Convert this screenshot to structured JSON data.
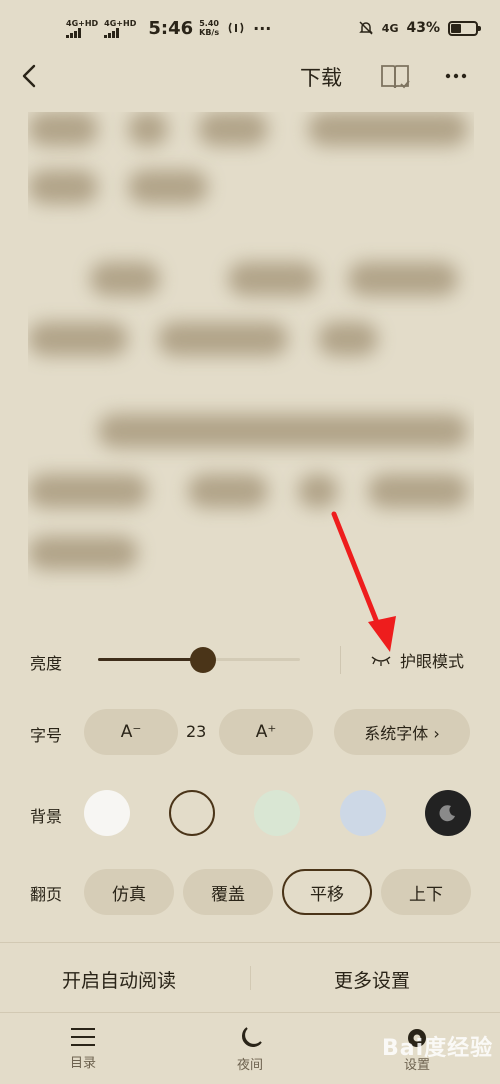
{
  "status_bar": {
    "sim1": "4G+HD",
    "sim2": "4G+HD",
    "time": "5:46",
    "speed_value": "5.40",
    "speed_unit": "KB/s",
    "more": "···",
    "network": "4G",
    "battery_percent": "43%",
    "battery_level": 0.43
  },
  "top_bar": {
    "download_label": "下载"
  },
  "brightness": {
    "label": "亮度",
    "level": 0.52,
    "eye_mode_label": "护眼模式"
  },
  "font": {
    "label": "字号",
    "decrease_label": "A⁻",
    "value": "23",
    "increase_label": "A⁺",
    "system_font_label": "系统字体 ›"
  },
  "background": {
    "label": "背景",
    "colors": [
      "#f7f6f3",
      "#e3dcc9",
      "#d9e6d3",
      "#cdd8e6",
      "#222222"
    ]
  },
  "page_turn": {
    "label": "翻页",
    "options": [
      "仿真",
      "覆盖",
      "平移",
      "上下"
    ],
    "selected": "平移"
  },
  "actions": {
    "auto_read": "开启自动阅读",
    "more_settings": "更多设置"
  },
  "tabs": {
    "catalog": "目录",
    "night": "夜间",
    "settings": "设置"
  },
  "watermark": "Bai度经验",
  "colors": {
    "accent": "#4a3418",
    "background": "#e3dcc9",
    "arrow": "#ee1d1d"
  }
}
